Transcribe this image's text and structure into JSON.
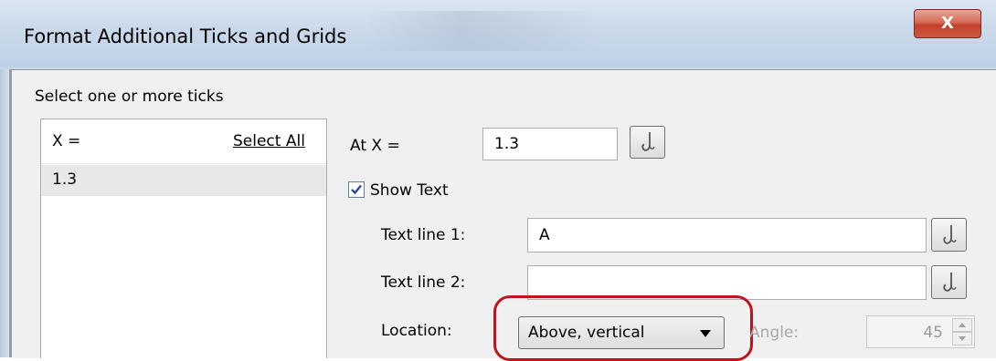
{
  "window": {
    "title": "Format Additional Ticks and Grids",
    "close_label": "X"
  },
  "tick_list": {
    "section_label": "Select one or more ticks",
    "column_header": "X =",
    "select_all_label": "Select All",
    "items": [
      "1.3"
    ]
  },
  "form": {
    "at_x_label": "At X =",
    "at_x_value": "1.3",
    "show_text_label": "Show Text",
    "show_text_checked": true,
    "text_line_1_label": "Text line 1:",
    "text_line_1_value": "A",
    "text_line_2_label": "Text line 2:",
    "text_line_2_value": "",
    "location_label": "Location:",
    "location_value": "Above, vertical",
    "angle_label": "Angle:",
    "angle_value": "45"
  },
  "icons": {
    "pick_button": "hook-icon",
    "checkbox": "checkmark-icon",
    "dropdown": "chevron-down-icon"
  },
  "colors": {
    "highlight_ring": "#c0141c",
    "close_button": "#c2402a",
    "title_bar": "#c9d9ea"
  }
}
